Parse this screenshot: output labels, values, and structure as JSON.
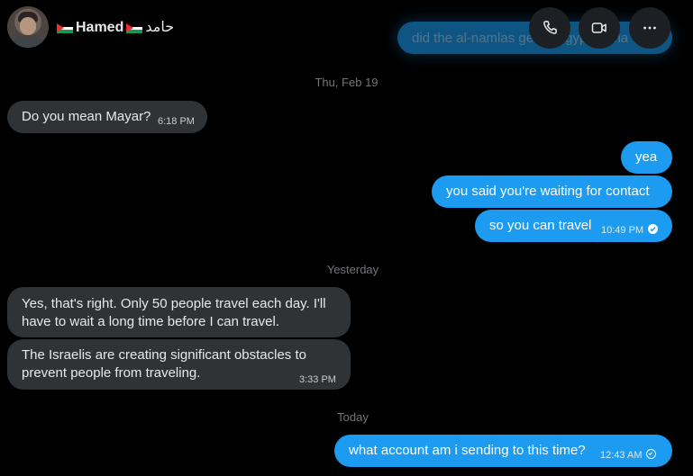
{
  "header": {
    "name": "Hamed",
    "arabic_name": "حامد",
    "buttons": {
      "call": "phone-icon",
      "video": "video-icon",
      "more": "more-icon"
    }
  },
  "partial_message": {
    "text": "did the al-namlas get to Egypt ha ha"
  },
  "separators": {
    "thu": "Thu, Feb 19",
    "yesterday": "Yesterday",
    "today": "Today"
  },
  "messages": [
    {
      "side": "in",
      "text": "Do you mean Mayar?",
      "time": "6:18 PM"
    },
    {
      "side": "out",
      "text": "yea"
    },
    {
      "side": "out",
      "text": "you said you're waiting for contact"
    },
    {
      "side": "out",
      "text": "so you can travel",
      "time": "10:49 PM",
      "status": "seen"
    },
    {
      "side": "in",
      "text": "Yes, that's right. Only 50 people travel each day. I'll have to wait a long time before I can travel."
    },
    {
      "side": "in",
      "text": "The Israelis are creating significant obstacles to prevent people from traveling.",
      "time": "3:33 PM"
    },
    {
      "side": "out",
      "text": "what account am i sending to this time?",
      "time": "12:43 AM",
      "status": "sent"
    }
  ],
  "colors": {
    "background": "#000000",
    "incoming_bubble": "#2f3336",
    "outgoing_bubble": "#1d9bf0",
    "muted_text": "#71767b"
  }
}
